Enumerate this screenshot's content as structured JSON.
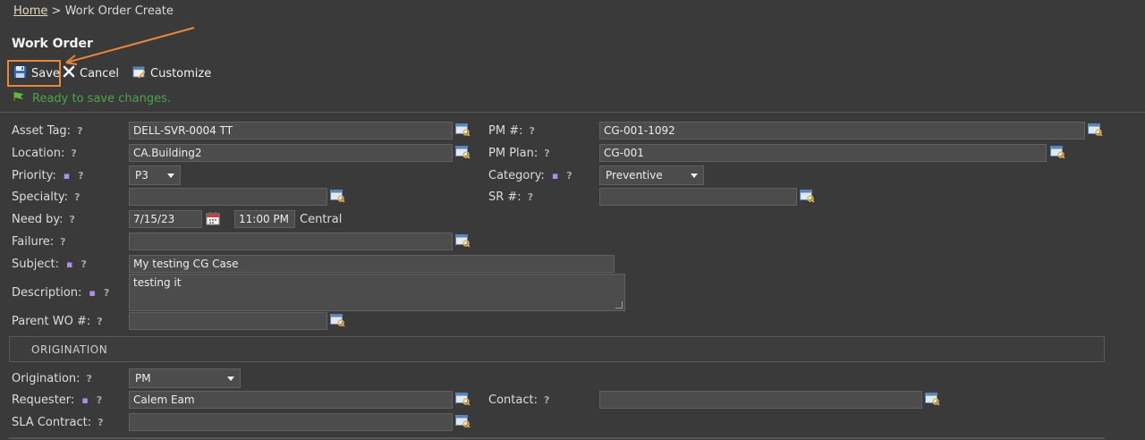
{
  "breadcrumb": {
    "home": "Home",
    "separator": " > ",
    "current": "Work Order Create"
  },
  "page_title": "Work Order",
  "toolbar": {
    "save_label": "Save",
    "cancel_label": "Cancel",
    "customize_label": "Customize"
  },
  "status_message": "Ready to save changes.",
  "fields": {
    "asset_tag": {
      "label": "Asset Tag:",
      "value": "DELL-SVR-0004 TT"
    },
    "pm_no": {
      "label": "PM #:",
      "value": "CG-001-1092"
    },
    "location": {
      "label": "Location:",
      "value": "CA.Building2"
    },
    "pm_plan": {
      "label": "PM Plan:",
      "value": "CG-001"
    },
    "priority": {
      "label": "Priority:",
      "value": "P3"
    },
    "category": {
      "label": "Category:",
      "value": "Preventive"
    },
    "specialty": {
      "label": "Specialty:",
      "value": ""
    },
    "sr_no": {
      "label": "SR #:",
      "value": ""
    },
    "need_by": {
      "label": "Need by:",
      "date": "7/15/23",
      "time": "11:00 PM",
      "timezone": "Central"
    },
    "failure": {
      "label": "Failure:",
      "value": ""
    },
    "subject": {
      "label": "Subject:",
      "value": "My testing CG Case"
    },
    "description": {
      "label": "Description:",
      "value": "testing it"
    },
    "parent_wo": {
      "label": "Parent WO #:",
      "value": ""
    }
  },
  "origination_section": {
    "header": "ORIGINATION",
    "origination": {
      "label": "Origination:",
      "value": "PM"
    },
    "requester": {
      "label": "Requester:",
      "value": "Calem Eam"
    },
    "contact": {
      "label": "Contact:",
      "value": ""
    },
    "sla_contract": {
      "label": "SLA Contract:",
      "value": ""
    }
  },
  "help_mark": "?",
  "required_mark": "▪",
  "colors": {
    "background": "#3a3a3a",
    "highlight": "#e8873a",
    "status_green": "#4aa54a",
    "required_purple": "#b48cf0"
  }
}
